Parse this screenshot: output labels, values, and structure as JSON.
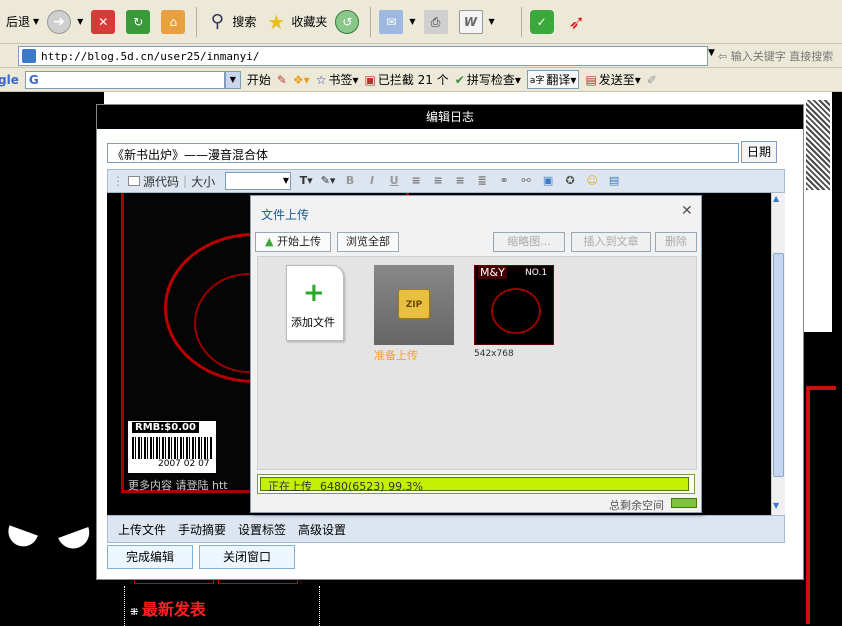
{
  "ie": {
    "back_label": "后退",
    "search_label": "搜索",
    "favorites_label": "收藏夹",
    "address_url": "http://blog.5d.cn/user25/inmanyi/",
    "keyword_hint": "输入关键字 直接搜索",
    "google_label": "gle",
    "google_box": "G",
    "start_label": "开始",
    "bookmarks_label": "书签",
    "blocked_label": "已拦截 21 个",
    "spell_label": "拼写检查",
    "translate_label": "翻译",
    "send_label": "发送至"
  },
  "dialog": {
    "title": "编辑日志",
    "post_title": "《新书出炉》——漫音混合体",
    "date_label": "日期",
    "toolbar": {
      "source_label": "源代码",
      "size_label": "大小"
    },
    "editor_caption": "更多内容 请登陆 htt",
    "barcode_price": "RMB:$0.00",
    "barcode_date": "2007 02 07",
    "bottom_tabs": [
      "上传文件",
      "手动摘要",
      "设置标签",
      "高级设置"
    ],
    "finish_button": "完成编辑",
    "close_button": "关闭窗口"
  },
  "upload": {
    "title": "文件上传",
    "start_upload": "开始上传",
    "browse_all": "浏览全部",
    "thumbnail": "缩略图...",
    "insert_article": "插入到文章",
    "delete": "删除",
    "add_file": "添加文件",
    "zip_status": "准备上传",
    "zip_label": "ZIP",
    "image_size": "542x768",
    "image_header": "M&Y",
    "image_no": "NO.1",
    "progress_label": "正在上传",
    "progress_detail": "6480(6523) 99.3%",
    "progress_value": 0.993,
    "remaining_label": "总剩余空间"
  },
  "page": {
    "latest_label": "最新发表"
  },
  "colors": {
    "accent_red": "#ff2020",
    "progress_green": "#c5f002",
    "title_blue": "#1a5a96"
  }
}
